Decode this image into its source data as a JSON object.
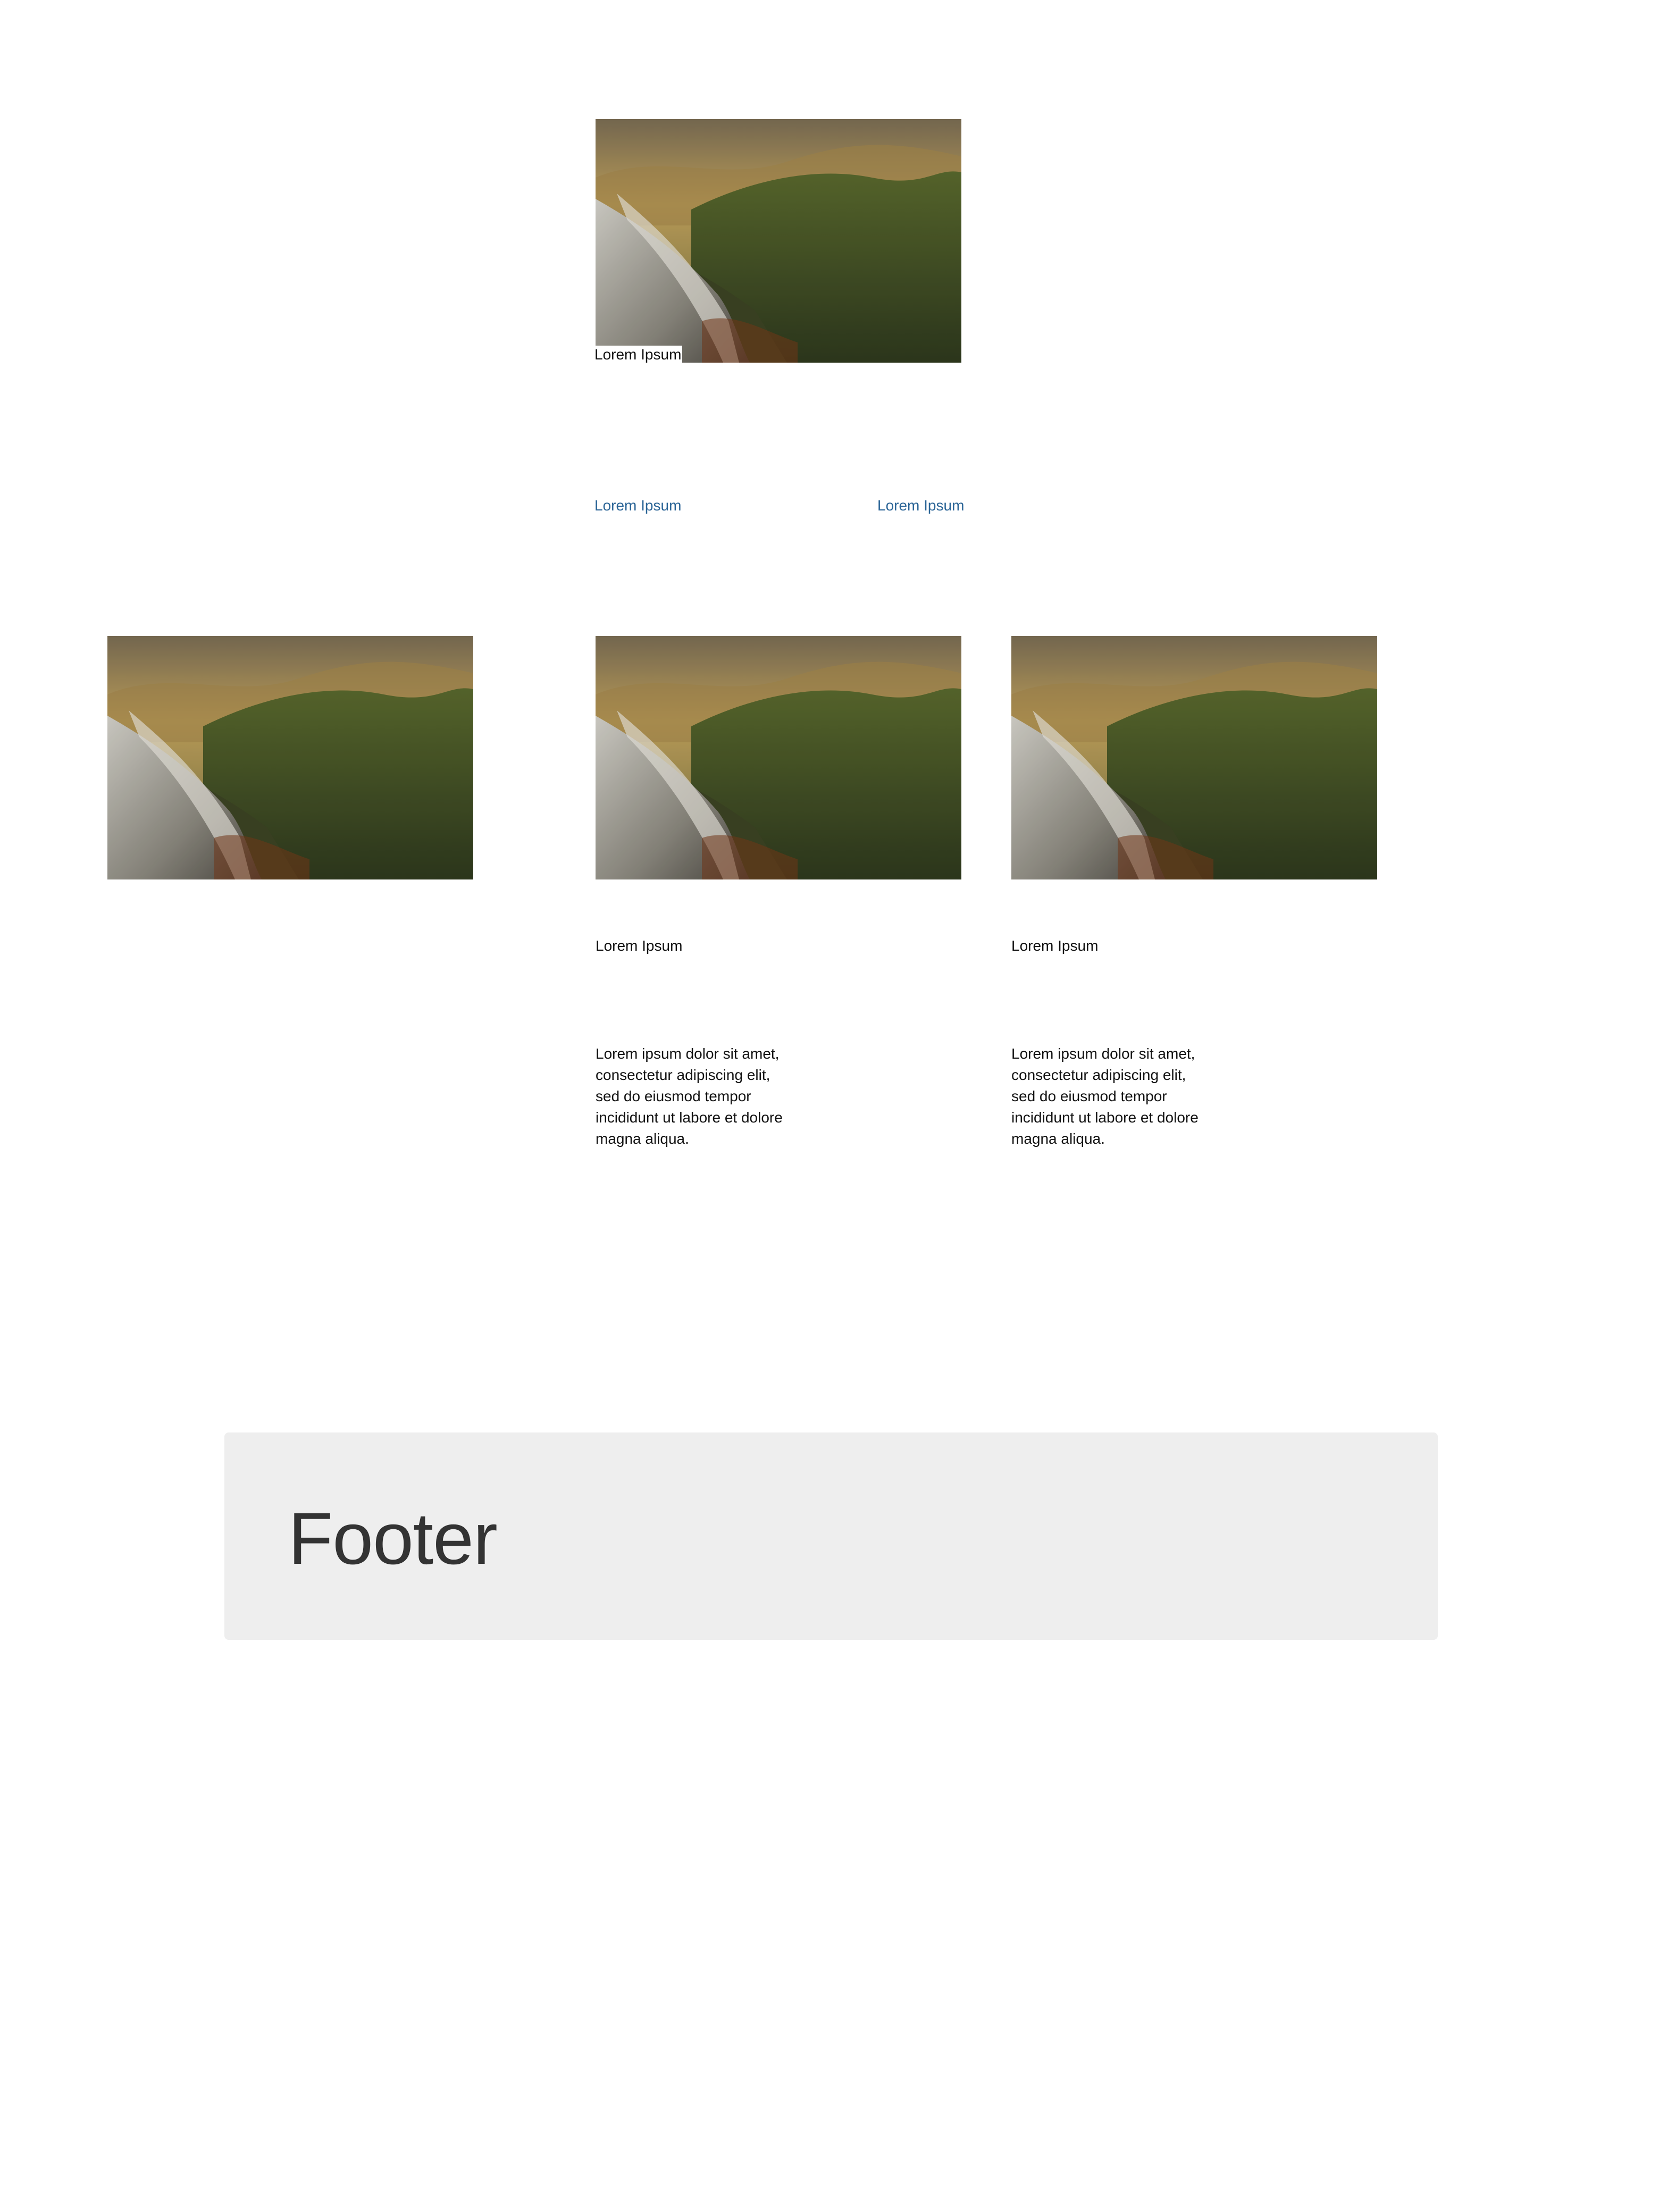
{
  "hero": {
    "image_alt": "mountain-landscape",
    "caption": "Lorem Ipsum"
  },
  "nav": {
    "left_link": "Lorem Ipsum",
    "right_link": "Lorem Ipsum"
  },
  "cards": [
    {
      "image_alt": "mountain-landscape"
    },
    {
      "image_alt": "mountain-landscape",
      "title": "Lorem Ipsum",
      "text": "Lorem ipsum dolor sit amet, consectetur adipiscing elit, sed do eiusmod tempor incididunt ut labore et dolore magna aliqua."
    },
    {
      "image_alt": "mountain-landscape",
      "title": "Lorem Ipsum",
      "text": "Lorem ipsum dolor sit amet, consectetur adipiscing elit, sed do eiusmod tempor incididunt ut labore et dolore magna aliqua."
    }
  ],
  "footer": {
    "title": "Footer"
  },
  "colors": {
    "link": "#2a6496",
    "footer_bg": "#eeeeee",
    "footer_text": "#333333",
    "body_text": "#111111"
  }
}
